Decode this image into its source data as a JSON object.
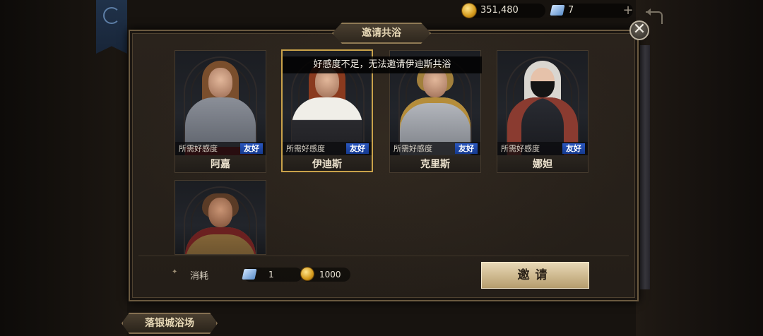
{
  "currency": {
    "gold_amount": "351,480",
    "ticket_amount": "7",
    "add_label": "+"
  },
  "dialog": {
    "title": "邀请共浴",
    "close_label": "✕",
    "tooltip": "好感度不足，无法邀请伊迪斯共浴"
  },
  "characters": [
    {
      "name": "阿嘉",
      "requirement_label": "所需好感度",
      "requirement_level": "友好"
    },
    {
      "name": "伊迪斯",
      "requirement_label": "所需好感度",
      "requirement_level": "友好"
    },
    {
      "name": "克里斯",
      "requirement_label": "所需好感度",
      "requirement_level": "友好"
    },
    {
      "name": "娜妲",
      "requirement_label": "所需好感度",
      "requirement_level": "友好"
    },
    {
      "name": "",
      "requirement_label": "",
      "requirement_level": ""
    }
  ],
  "cost": {
    "label": "消耗",
    "ticket_cost": "1",
    "gold_cost": "1000"
  },
  "invite_button": "邀请",
  "location": "落银城浴场",
  "colors": {
    "badge_blue": "#1f4fb8",
    "selected_border": "#c9a24a",
    "gold": "#d49a1c"
  }
}
